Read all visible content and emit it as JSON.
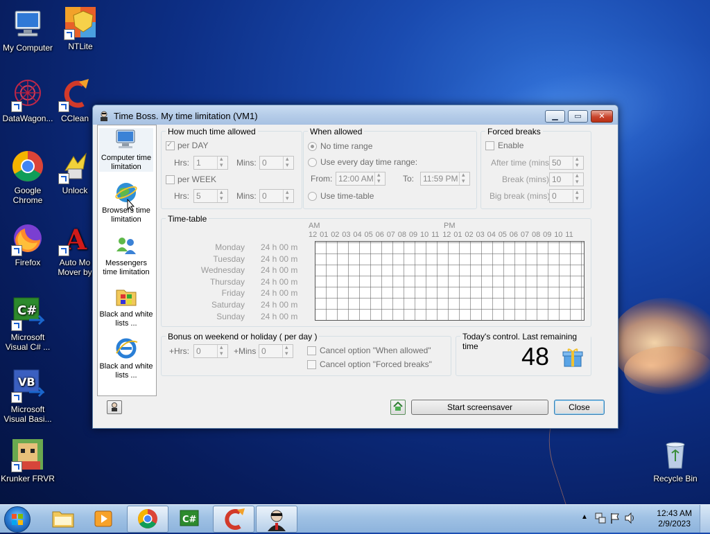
{
  "desktop": {
    "icons": [
      {
        "label": "My Computer"
      },
      {
        "label": "NTLite"
      },
      {
        "label": "DataWagon..."
      },
      {
        "label": "CClean"
      },
      {
        "label": "Google Chrome"
      },
      {
        "label": "Unlock"
      },
      {
        "label": "Firefox"
      },
      {
        "label": "Auto Mo Mover by"
      },
      {
        "label": "Microsoft Visual C# ..."
      },
      {
        "label": "Microsoft Visual Basi..."
      },
      {
        "label": "Krunker FRVR"
      },
      {
        "label": "Recycle Bin"
      }
    ]
  },
  "window": {
    "title": "Time Boss. My time limitation (VM1)",
    "sidebar": [
      {
        "label": "Computer time limitation",
        "icon": "computer-time-icon"
      },
      {
        "label": "Browsers time limitation",
        "icon": "browser-globe-icon"
      },
      {
        "label": "Messengers time limitation",
        "icon": "messengers-icon"
      },
      {
        "label": "Black and white lists ...",
        "icon": "apps-list-icon"
      },
      {
        "label": "Black and white lists ...",
        "icon": "ie-list-icon"
      }
    ],
    "how_much": {
      "title": "How much time allowed",
      "per_day": "per DAY",
      "per_day_checked": true,
      "day_hrs_label": "Hrs:",
      "day_hrs": "1",
      "day_mins_label": "Mins:",
      "day_mins": "0",
      "per_week": "per WEEK",
      "per_week_checked": false,
      "week_hrs_label": "Hrs:",
      "week_hrs": "5",
      "week_mins_label": "Mins:",
      "week_mins": "0"
    },
    "when_allowed": {
      "title": "When allowed",
      "no_range": "No time range",
      "every_day": "Use every day time range:",
      "from_label": "From:",
      "from": "12:00 AM",
      "to_label": "To:",
      "to": "11:59 PM",
      "use_timetable": "Use time-table",
      "selected": "no_range"
    },
    "forced_breaks": {
      "title": "Forced breaks",
      "enable": "Enable",
      "after_label": "After time (mins):",
      "after": "50",
      "break_label": "Break (mins):",
      "break": "10",
      "big_label": "Big break (mins):",
      "big": "0"
    },
    "timetable": {
      "title": "Time-table",
      "am": "AM",
      "pm": "PM",
      "hours": [
        "12",
        "01",
        "02",
        "03",
        "04",
        "05",
        "06",
        "07",
        "08",
        "09",
        "10",
        "11",
        "12",
        "01",
        "02",
        "03",
        "04",
        "05",
        "06",
        "07",
        "08",
        "09",
        "10",
        "11"
      ],
      "days": [
        {
          "day": "Monday",
          "total": "24 h 00 m"
        },
        {
          "day": "Tuesday",
          "total": "24 h 00 m"
        },
        {
          "day": "Wednesday",
          "total": "24 h 00 m"
        },
        {
          "day": "Thursday",
          "total": "24 h 00 m"
        },
        {
          "day": "Friday",
          "total": "24 h 00 m"
        },
        {
          "day": "Saturday",
          "total": "24 h 00 m"
        },
        {
          "day": "Sunday",
          "total": "24 h 00 m"
        }
      ]
    },
    "bonus": {
      "title": "Bonus on weekend or holiday ( per day )",
      "hrs_label": "+Hrs:",
      "hrs": "0",
      "mins_label": "+Mins",
      "mins": "0",
      "cancel_when": "Cancel option \"When allowed\"",
      "cancel_breaks": "Cancel option \"Forced breaks\""
    },
    "today": {
      "title": "Today's control. Last remaining time",
      "value": "48"
    },
    "buttons": {
      "start_screensaver": "Start screensaver",
      "close": "Close"
    }
  },
  "taskbar": {
    "time": "12:43 AM",
    "date": "2/9/2023"
  }
}
